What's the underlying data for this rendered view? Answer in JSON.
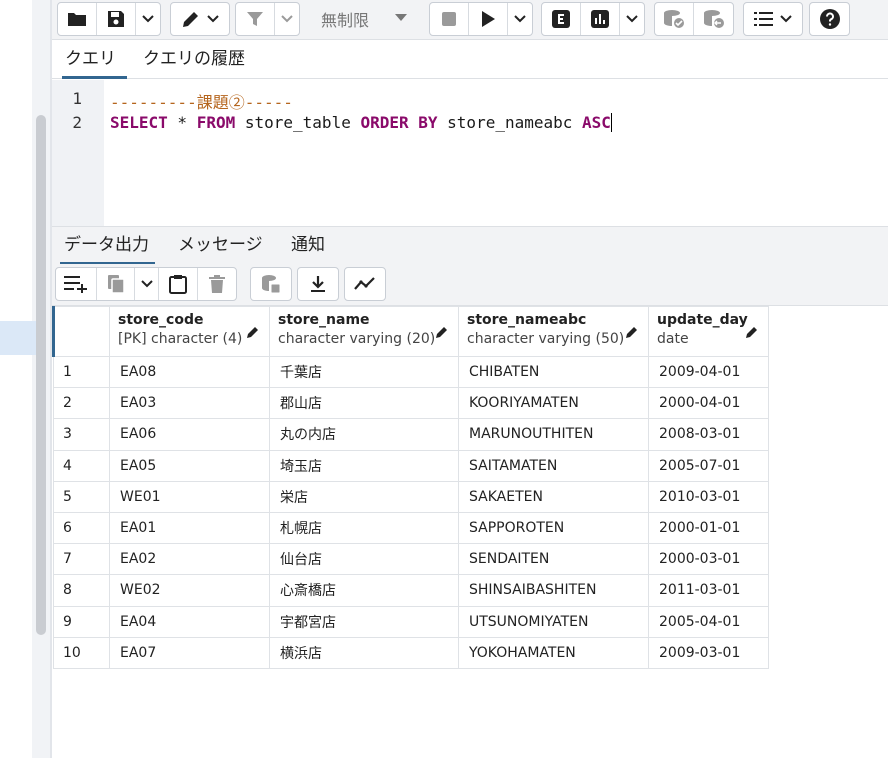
{
  "toolbar": {
    "icons": [
      "folder-icon",
      "save-icon",
      "chevron-down-icon",
      "edit-icon",
      "chevron-down-icon",
      "filter-icon",
      "chevron-down-icon",
      "stop-icon",
      "play-icon",
      "chevron-down-icon",
      "explain-icon",
      "explain-analyze-icon",
      "chevron-down-icon",
      "commit-icon",
      "rollback-icon",
      "macros-icon",
      "help-icon"
    ],
    "limit_value": "無制限"
  },
  "query_tabs": [
    "クエリ",
    "クエリの履歴"
  ],
  "editor": {
    "line_numbers": [
      "1",
      "2"
    ],
    "line1_comment": "---------課題②-----",
    "line2": {
      "select": "SELECT",
      "star": " * ",
      "from": "FROM",
      "table": " store_table ",
      "orderby": "ORDER BY",
      "column": " store_nameabc ",
      "asc": "ASC"
    }
  },
  "output_tabs": [
    "データ出力",
    "メッセージ",
    "通知"
  ],
  "result_toolbar": {
    "icons": [
      "add-row-icon",
      "copy-icon",
      "chevron-down-icon",
      "paste-icon",
      "delete-icon",
      "save-data-icon",
      "download-icon",
      "graph-icon"
    ]
  },
  "grid": {
    "columns": [
      {
        "name": "store_code",
        "type": "[PK] character (4)"
      },
      {
        "name": "store_name",
        "type": "character varying (20)"
      },
      {
        "name": "store_nameabc",
        "type": "character varying (50)"
      },
      {
        "name": "update_day",
        "type": "date"
      }
    ],
    "rows": [
      [
        "1",
        "EA08",
        "千葉店",
        "CHIBATEN",
        "2009-04-01"
      ],
      [
        "2",
        "EA03",
        "郡山店",
        "KOORIYAMATEN",
        "2000-04-01"
      ],
      [
        "3",
        "EA06",
        "丸の内店",
        "MARUNOUTHITEN",
        "2008-03-01"
      ],
      [
        "4",
        "EA05",
        "埼玉店",
        "SAITAMATEN",
        "2005-07-01"
      ],
      [
        "5",
        "WE01",
        "栄店",
        "SAKAETEN",
        "2010-03-01"
      ],
      [
        "6",
        "EA01",
        "札幌店",
        "SAPPOROTEN",
        "2000-01-01"
      ],
      [
        "7",
        "EA02",
        "仙台店",
        "SENDAITEN",
        "2000-03-01"
      ],
      [
        "8",
        "WE02",
        "心斎橋店",
        "SHINSAIBASHITEN",
        "2011-03-01"
      ],
      [
        "9",
        "EA04",
        "宇都宮店",
        "UTSUNOMIYATEN",
        "2005-04-01"
      ],
      [
        "10",
        "EA07",
        "横浜店",
        "YOKOHAMATEN",
        "2009-03-01"
      ]
    ]
  },
  "colors": {
    "accent": "#326690",
    "keyword": "#8a0a6a",
    "comment": "#b5651d"
  }
}
